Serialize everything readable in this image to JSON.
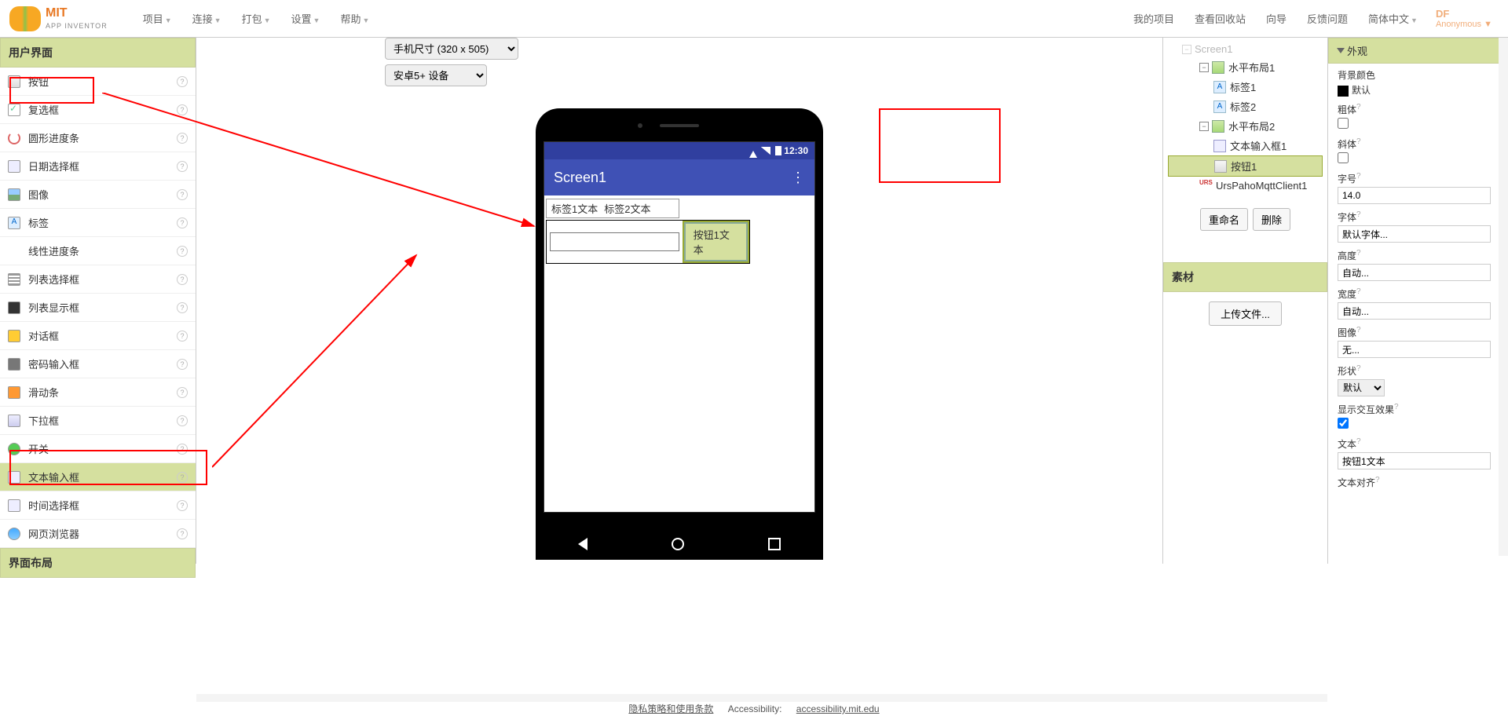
{
  "logo": {
    "mit": "MIT",
    "sub": "APP INVENTOR"
  },
  "nav_left": [
    {
      "label": "项目"
    },
    {
      "label": "连接"
    },
    {
      "label": "打包"
    },
    {
      "label": "设置"
    },
    {
      "label": "帮助"
    }
  ],
  "nav_right": [
    {
      "label": "我的项目"
    },
    {
      "label": "查看回收站"
    },
    {
      "label": "向导"
    },
    {
      "label": "反馈问题"
    },
    {
      "label": "简体中文"
    }
  ],
  "anon": {
    "df": "DF",
    "label": "Anonymous"
  },
  "palette_header": "用户界面",
  "palette_items": [
    {
      "label": "按钮",
      "iconClass": "pi-button"
    },
    {
      "label": "复选框",
      "iconClass": "pi-checkbox"
    },
    {
      "label": "圆形进度条",
      "iconClass": "pi-circle"
    },
    {
      "label": "日期选择框",
      "iconClass": "pi-date"
    },
    {
      "label": "图像",
      "iconClass": "pi-image"
    },
    {
      "label": "标签",
      "iconClass": "pi-label"
    },
    {
      "label": "线性进度条",
      "iconClass": "pi-linear"
    },
    {
      "label": "列表选择框",
      "iconClass": "pi-listpicker"
    },
    {
      "label": "列表显示框",
      "iconClass": "pi-listview"
    },
    {
      "label": "对话框",
      "iconClass": "pi-notifier"
    },
    {
      "label": "密码输入框",
      "iconClass": "pi-passwd"
    },
    {
      "label": "滑动条",
      "iconClass": "pi-slider"
    },
    {
      "label": "下拉框",
      "iconClass": "pi-spinner"
    },
    {
      "label": "开关",
      "iconClass": "pi-switch"
    },
    {
      "label": "文本输入框",
      "iconClass": "pi-textbox",
      "highlighted": true
    },
    {
      "label": "时间选择框",
      "iconClass": "pi-timepicker"
    },
    {
      "label": "网页浏览器",
      "iconClass": "pi-webview"
    }
  ],
  "palette_layout_header": "界面布局",
  "viewer": {
    "phone_size": "手机尺寸 (320 x 505)",
    "android_ver": "安卓5+ 设备",
    "status_time": "12:30",
    "screen_title": "Screen1",
    "label1": "标签1文本",
    "label2": "标签2文本",
    "button1": "按钮1文本"
  },
  "components": {
    "screen": "Screen1",
    "ha1": "水平布局1",
    "label1": "标签1",
    "label2": "标签2",
    "ha2": "水平布局2",
    "textbox1": "文本输入框1",
    "button1": "按钮1",
    "mqtt": "UrsPahoMqttClient1",
    "rename": "重命名",
    "delete": "删除"
  },
  "media": {
    "header": "素材",
    "upload": "上传文件..."
  },
  "properties": {
    "header": "外观",
    "bgcolor_label": "背景颜色",
    "bgcolor_value": "默认",
    "bold_label": "粗体",
    "bold_checked": false,
    "italic_label": "斜体",
    "italic_checked": false,
    "fontsize_label": "字号",
    "fontsize_value": "14.0",
    "fontface_label": "字体",
    "fontface_value": "默认字体...",
    "height_label": "高度",
    "height_value": "自动...",
    "width_label": "宽度",
    "width_value": "自动...",
    "image_label": "图像",
    "image_value": "无...",
    "shape_label": "形状",
    "shape_value": "默认",
    "feedback_label": "显示交互效果",
    "feedback_checked": true,
    "text_label": "文本",
    "text_value": "按钮1文本",
    "align_label": "文本对齐"
  },
  "footer": {
    "privacy": "隐私策略和使用条款",
    "accessibility_label": "Accessibility:",
    "accessibility_link": "accessibility.mit.edu"
  }
}
